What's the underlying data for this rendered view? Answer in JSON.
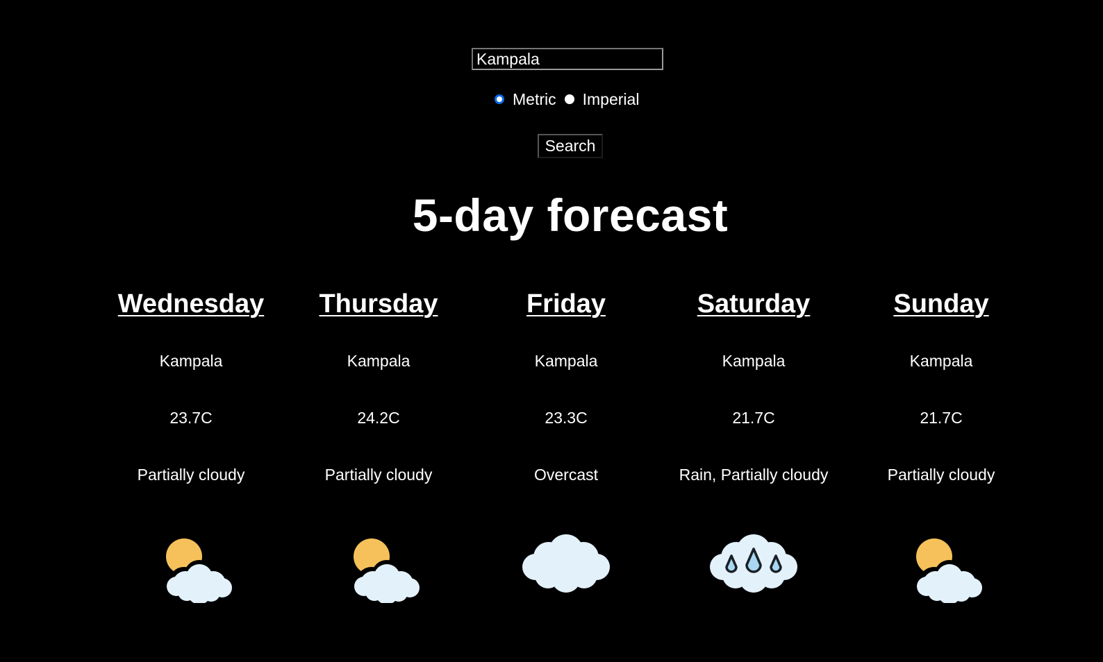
{
  "search": {
    "value": "Kampala",
    "button_label": "Search"
  },
  "units": {
    "selected": "Metric",
    "options": [
      "Metric",
      "Imperial"
    ]
  },
  "title": "5-day forecast",
  "days": [
    {
      "name": "Wednesday",
      "city": "Kampala",
      "temp": "23.7C",
      "condition": "Partially cloudy",
      "icon": "partly-cloudy-icon"
    },
    {
      "name": "Thursday",
      "city": "Kampala",
      "temp": "24.2C",
      "condition": "Partially cloudy",
      "icon": "partly-cloudy-icon"
    },
    {
      "name": "Friday",
      "city": "Kampala",
      "temp": "23.3C",
      "condition": "Overcast",
      "icon": "cloud-icon"
    },
    {
      "name": "Saturday",
      "city": "Kampala",
      "temp": "21.7C",
      "condition": "Rain, Partially cloudy",
      "icon": "rain-cloud-icon"
    },
    {
      "name": "Sunday",
      "city": "Kampala",
      "temp": "21.7C",
      "condition": "Partially cloudy",
      "icon": "partly-cloudy-icon"
    }
  ],
  "colors": {
    "background": "#000000",
    "text": "#ffffff",
    "sun": "#f6c15a",
    "cloud": "#e3f1fb",
    "raindrop": "#a9d6f0",
    "radio_accent": "#0a6ce8"
  }
}
